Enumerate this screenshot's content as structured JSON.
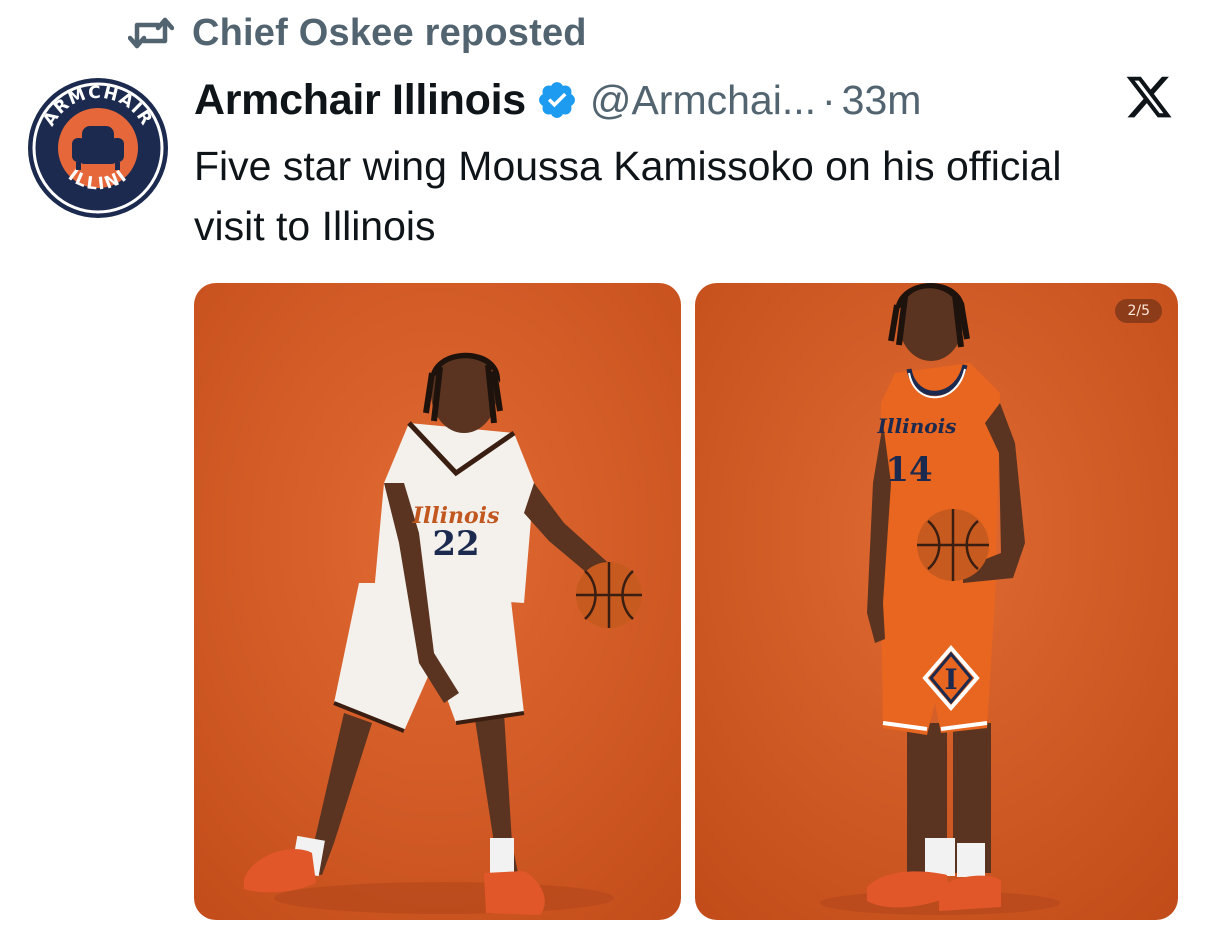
{
  "repost": {
    "text": "Chief Oskee reposted",
    "icon": "repost-icon"
  },
  "author": {
    "display_name": "Armchair Illinois",
    "handle": "@Armchai...",
    "separator": "·",
    "time": "33m",
    "verified": true,
    "avatar": {
      "top_text": "ARMCHAIR",
      "bottom_text": "ILLINI",
      "ring_color": "#1b2a4e",
      "fill_color": "#e5673a"
    }
  },
  "tweet": {
    "text": "Five star wing Moussa Kamissoko on his official visit to Illinois"
  },
  "media": {
    "counter": "2/5",
    "photos": [
      {
        "jersey_text": "Illinois",
        "jersey_number": "22",
        "jersey_color": "#f4f1ec"
      },
      {
        "jersey_text": "Illinois",
        "jersey_number": "14",
        "jersey_color": "#e8661f"
      }
    ]
  },
  "colors": {
    "text_primary": "#0f1419",
    "text_secondary": "#536471",
    "verified_blue": "#1d9bf0",
    "photo_background": "#d85a24"
  }
}
